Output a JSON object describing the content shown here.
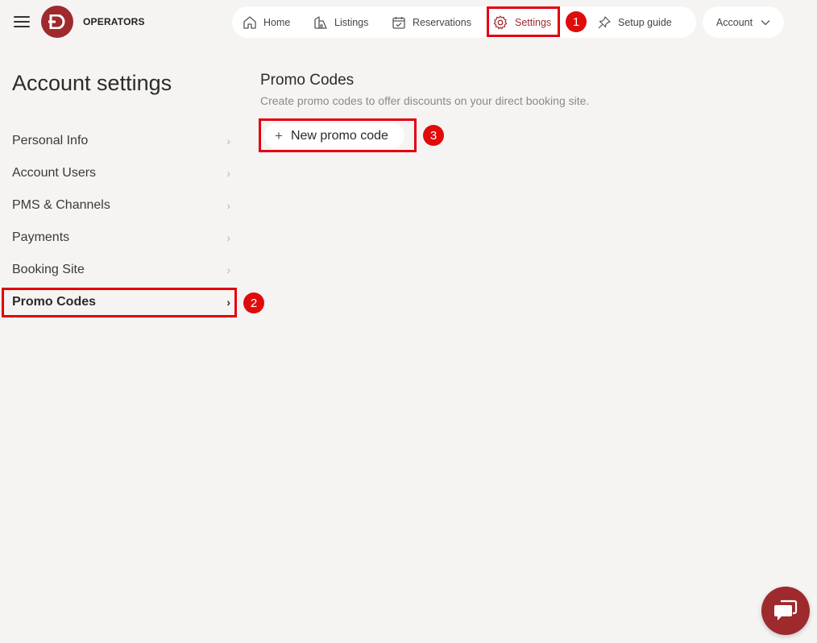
{
  "header": {
    "brand": "OPERATORS",
    "logo_letter": "D",
    "nav": [
      {
        "label": "Home",
        "icon": "home-icon"
      },
      {
        "label": "Listings",
        "icon": "listings-icon"
      },
      {
        "label": "Reservations",
        "icon": "calendar-icon"
      },
      {
        "label": "Settings",
        "icon": "gear-icon",
        "active": true
      }
    ],
    "setup_guide": "Setup guide",
    "account": "Account"
  },
  "sidebar": {
    "title": "Account settings",
    "items": [
      {
        "label": "Personal Info"
      },
      {
        "label": "Account Users"
      },
      {
        "label": "PMS & Channels"
      },
      {
        "label": "Payments"
      },
      {
        "label": "Booking Site"
      },
      {
        "label": "Promo Codes",
        "active": true
      }
    ],
    "chevron": "›"
  },
  "main": {
    "title": "Promo Codes",
    "description": "Create promo codes to offer discounts on your direct booking site.",
    "new_button": "New promo code",
    "plus": "+"
  },
  "annotations": {
    "badge_1": "1",
    "badge_2": "2",
    "badge_3": "3"
  },
  "colors": {
    "brand": "#9e2a2e",
    "highlight": "#e3000f",
    "background": "#f5f4f2"
  }
}
